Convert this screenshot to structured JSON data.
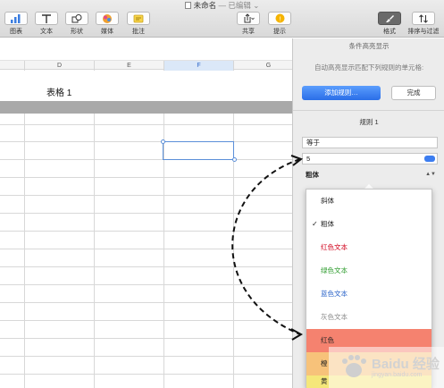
{
  "titlebar": {
    "doc_name": "未命名",
    "status": "— 已编辑 ⌄"
  },
  "toolbar": {
    "chart": "图表",
    "text": "文本",
    "shape": "形状",
    "media": "媒体",
    "comment": "批注",
    "share": "共享",
    "tips": "提示",
    "format": "格式",
    "sort_filter": "排序与过滤"
  },
  "sheet": {
    "columns": [
      "D",
      "E",
      "F",
      "G"
    ],
    "selected_column": "F",
    "table_title": "表格 1"
  },
  "panel": {
    "title": "条件高亮显示",
    "description": "自动高亮显示匹配下列规则的单元格:",
    "add_rule": "添加规则…",
    "done": "完成",
    "rule_title": "规则 1",
    "condition": "等于",
    "value": "5",
    "style_selected": "粗体"
  },
  "menu": {
    "items": [
      {
        "label": "斜体",
        "color": "#222222",
        "bg": "#ffffff",
        "checked": ""
      },
      {
        "label": "粗体",
        "color": "#222222",
        "bg": "#ffffff",
        "checked": "✓"
      },
      {
        "label": "红色文本",
        "color": "#d0021b",
        "bg": "#ffffff",
        "checked": ""
      },
      {
        "label": "绿色文本",
        "color": "#2e9c2e",
        "bg": "#ffffff",
        "checked": ""
      },
      {
        "label": "蓝色文本",
        "color": "#2a63c8",
        "bg": "#ffffff",
        "checked": ""
      },
      {
        "label": "灰色文本",
        "color": "#8a8a8a",
        "bg": "#ffffff",
        "checked": ""
      },
      {
        "label": "红色",
        "color": "#222222",
        "bg": "#f5826f",
        "checked": ""
      },
      {
        "label": "橙",
        "color": "#222222",
        "bg": "#f7c27a",
        "checked": ""
      },
      {
        "label": "黄",
        "color": "#222222",
        "bg": "#f5e77a",
        "checked": ""
      }
    ]
  },
  "watermark": {
    "text": "Baidu 经验",
    "url": "jingyan.baidu.com"
  }
}
